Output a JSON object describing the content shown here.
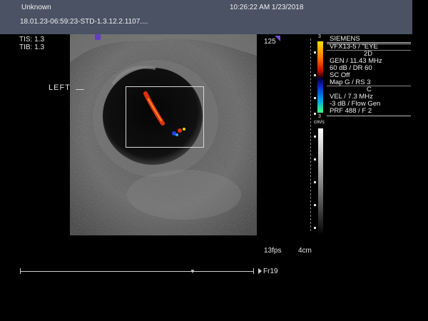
{
  "header": {
    "patient": "Unknown",
    "datetime": "10:26:22 AM 1/23/2018",
    "study_id": "18.01.23-06:59:23-STD-1.3.12.2.1107...."
  },
  "safety": {
    "tis": "TIS: 1.3",
    "tib": "TIB: 1.3"
  },
  "labels": {
    "side": "LEFT",
    "depth_marker": "125"
  },
  "info_panel": {
    "color_scale_top": "3",
    "color_scale_bottom": "3",
    "units": "cm/s",
    "lines": [
      "SIEMENS",
      "VFX13-5 / \"EYE",
      "2D",
      "GEN / 11.43 MHz",
      "60 dB / DR 60",
      "SC Off",
      "Map G / RS 3",
      "C",
      "VEL / 7.3 MHz",
      "-3 dB / Flow Gen",
      "PRF 488 / F 2"
    ]
  },
  "status": {
    "fps": "13fps",
    "depth": "4cm",
    "frame": "Fr19"
  },
  "colors": {
    "topbar": "#4a5264",
    "doppler_red": "#e03010",
    "doppler_blue": "#2040ff"
  }
}
